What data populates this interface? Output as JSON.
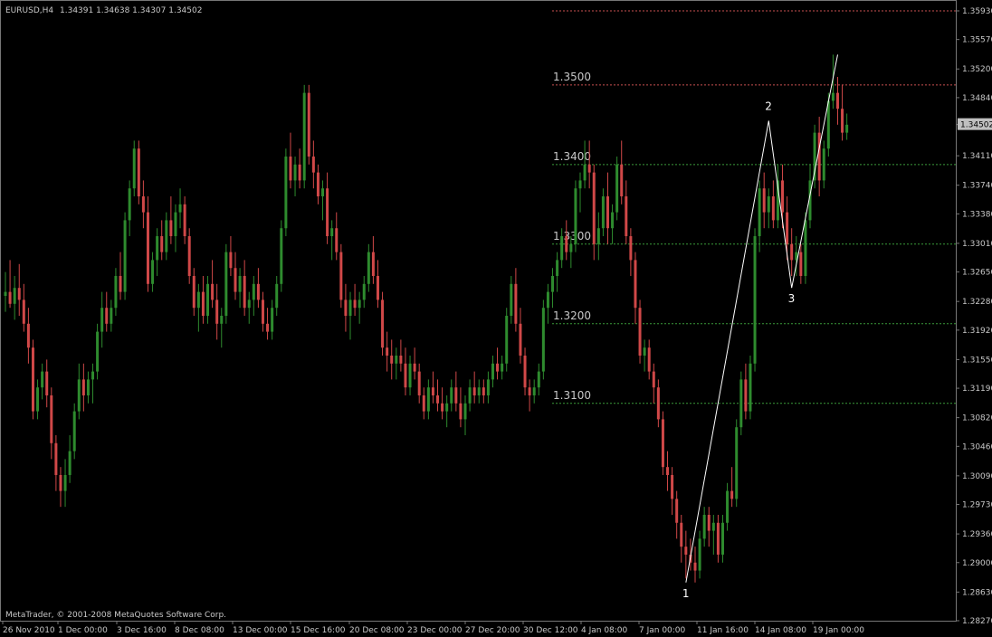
{
  "header": {
    "symbol": "EURUSD,H4",
    "quote": "1.34391 1.34638 1.34307 1.34502"
  },
  "footer": {
    "copyright": "MetaTrader, © 2001-2008 MetaQuotes Software Corp."
  },
  "colors": {
    "background": "#000000",
    "bull": "#2e8b2e",
    "bear": "#d04848",
    "grid": "#555555",
    "wave": "#ffffff",
    "price_marker": "#c0c0c0"
  },
  "chart_data": {
    "type": "candlestick",
    "symbol": "EURUSD",
    "timeframe": "H4",
    "ylim": [
      1.2827,
      1.3593
    ],
    "y_ticks": [
      "1.35930",
      "1.35570",
      "1.35200",
      "1.34840",
      "1.34502",
      "1.34110",
      "1.33740",
      "1.33380",
      "1.33010",
      "1.32650",
      "1.32280",
      "1.31920",
      "1.31550",
      "1.31190",
      "1.30820",
      "1.30460",
      "1.30090",
      "1.29730",
      "1.29360",
      "1.29000",
      "1.28630",
      "1.28270"
    ],
    "x_ticks": [
      "26 Nov 2010",
      "1 Dec 00:00",
      "3 Dec 16:00",
      "8 Dec 08:00",
      "13 Dec 00:00",
      "15 Dec 16:00",
      "20 Dec 08:00",
      "23 Dec 00:00",
      "27 Dec 20:00",
      "30 Dec 12:00",
      "4 Jan 08:00",
      "7 Jan 00:00",
      "11 Jan 16:00",
      "14 Jan 08:00",
      "19 Jan 00:00"
    ],
    "current_price": "1.34502",
    "levels": [
      {
        "label": "",
        "value": 1.3593
      },
      {
        "label": "1.3500",
        "value": 1.35
      },
      {
        "label": "1.3400",
        "value": 1.34
      },
      {
        "label": "1.3300",
        "value": 1.33
      },
      {
        "label": "1.3200",
        "value": 1.32
      },
      {
        "label": "1.3100",
        "value": 1.31
      }
    ],
    "wave_points": [
      {
        "label": "",
        "index": 148,
        "price": 1.2875
      },
      {
        "label": "",
        "index": 166,
        "price": 1.3455
      },
      {
        "label": "",
        "index": 171,
        "price": 1.3245
      },
      {
        "label": "",
        "index": 181,
        "price": 1.3538
      }
    ],
    "wave_labels": [
      {
        "label": "1",
        "index": 148,
        "price": 1.2875
      },
      {
        "label": "2",
        "index": 166,
        "price": 1.3455
      },
      {
        "label": "3",
        "index": 171,
        "price": 1.3245
      }
    ],
    "candles": [
      [
        1.3235,
        1.3265,
        1.3215,
        1.324
      ],
      [
        1.324,
        1.328,
        1.322,
        1.3225
      ],
      [
        1.3225,
        1.326,
        1.3205,
        1.3245
      ],
      [
        1.3245,
        1.3275,
        1.321,
        1.323
      ],
      [
        1.323,
        1.325,
        1.319,
        1.32
      ],
      [
        1.32,
        1.322,
        1.315,
        1.317
      ],
      [
        1.317,
        1.318,
        1.308,
        1.309
      ],
      [
        1.309,
        1.313,
        1.308,
        1.312
      ],
      [
        1.312,
        1.315,
        1.3105,
        1.314
      ],
      [
        1.314,
        1.3155,
        1.3095,
        1.311
      ],
      [
        1.311,
        1.312,
        1.303,
        1.305
      ],
      [
        1.305,
        1.306,
        1.299,
        1.301
      ],
      [
        1.301,
        1.302,
        1.297,
        1.299
      ],
      [
        1.299,
        1.303,
        1.297,
        1.301
      ],
      [
        1.301,
        1.306,
        1.3,
        1.304
      ],
      [
        1.304,
        1.31,
        1.303,
        1.309
      ],
      [
        1.309,
        1.315,
        1.308,
        1.313
      ],
      [
        1.313,
        1.315,
        1.309,
        1.311
      ],
      [
        1.311,
        1.314,
        1.31,
        1.313
      ],
      [
        1.313,
        1.315,
        1.31,
        1.314
      ],
      [
        1.314,
        1.32,
        1.313,
        1.319
      ],
      [
        1.319,
        1.324,
        1.317,
        1.322
      ],
      [
        1.322,
        1.324,
        1.319,
        1.32
      ],
      [
        1.32,
        1.323,
        1.319,
        1.322
      ],
      [
        1.322,
        1.327,
        1.321,
        1.326
      ],
      [
        1.326,
        1.329,
        1.323,
        1.324
      ],
      [
        1.324,
        1.334,
        1.323,
        1.333
      ],
      [
        1.333,
        1.338,
        1.331,
        1.337
      ],
      [
        1.337,
        1.343,
        1.336,
        1.342
      ],
      [
        1.342,
        1.343,
        1.335,
        1.336
      ],
      [
        1.336,
        1.338,
        1.332,
        1.334
      ],
      [
        1.334,
        1.336,
        1.324,
        1.325
      ],
      [
        1.325,
        1.329,
        1.324,
        1.328
      ],
      [
        1.328,
        1.332,
        1.326,
        1.331
      ],
      [
        1.331,
        1.333,
        1.328,
        1.329
      ],
      [
        1.329,
        1.334,
        1.328,
        1.333
      ],
      [
        1.333,
        1.336,
        1.33,
        1.331
      ],
      [
        1.331,
        1.335,
        1.329,
        1.334
      ],
      [
        1.334,
        1.337,
        1.332,
        1.335
      ],
      [
        1.335,
        1.336,
        1.33,
        1.331
      ],
      [
        1.331,
        1.332,
        1.325,
        1.326
      ],
      [
        1.326,
        1.327,
        1.321,
        1.322
      ],
      [
        1.322,
        1.325,
        1.319,
        1.324
      ],
      [
        1.324,
        1.326,
        1.32,
        1.321
      ],
      [
        1.321,
        1.326,
        1.32,
        1.325
      ],
      [
        1.325,
        1.328,
        1.322,
        1.323
      ],
      [
        1.323,
        1.325,
        1.318,
        1.32
      ],
      [
        1.32,
        1.322,
        1.317,
        1.321
      ],
      [
        1.321,
        1.33,
        1.32,
        1.329
      ],
      [
        1.329,
        1.331,
        1.326,
        1.327
      ],
      [
        1.327,
        1.329,
        1.323,
        1.324
      ],
      [
        1.324,
        1.327,
        1.322,
        1.326
      ],
      [
        1.326,
        1.328,
        1.321,
        1.322
      ],
      [
        1.322,
        1.324,
        1.32,
        1.323
      ],
      [
        1.323,
        1.326,
        1.321,
        1.325
      ],
      [
        1.325,
        1.327,
        1.322,
        1.323
      ],
      [
        1.323,
        1.324,
        1.319,
        1.32
      ],
      [
        1.32,
        1.322,
        1.318,
        1.319
      ],
      [
        1.319,
        1.323,
        1.318,
        1.322
      ],
      [
        1.322,
        1.326,
        1.321,
        1.325
      ],
      [
        1.325,
        1.333,
        1.324,
        1.332
      ],
      [
        1.332,
        1.342,
        1.331,
        1.341
      ],
      [
        1.341,
        1.344,
        1.337,
        1.338
      ],
      [
        1.338,
        1.341,
        1.336,
        1.34
      ],
      [
        1.34,
        1.342,
        1.337,
        1.338
      ],
      [
        1.338,
        1.35,
        1.337,
        1.349
      ],
      [
        1.349,
        1.35,
        1.34,
        1.341
      ],
      [
        1.341,
        1.343,
        1.337,
        1.339
      ],
      [
        1.339,
        1.34,
        1.335,
        1.336
      ],
      [
        1.336,
        1.338,
        1.333,
        1.337
      ],
      [
        1.337,
        1.339,
        1.33,
        1.331
      ],
      [
        1.331,
        1.333,
        1.328,
        1.332
      ],
      [
        1.332,
        1.334,
        1.328,
        1.329
      ],
      [
        1.329,
        1.33,
        1.322,
        1.323
      ],
      [
        1.323,
        1.325,
        1.319,
        1.321
      ],
      [
        1.321,
        1.324,
        1.318,
        1.323
      ],
      [
        1.323,
        1.325,
        1.321,
        1.322
      ],
      [
        1.322,
        1.324,
        1.32,
        1.323
      ],
      [
        1.323,
        1.326,
        1.322,
        1.325
      ],
      [
        1.325,
        1.33,
        1.324,
        1.329
      ],
      [
        1.329,
        1.331,
        1.325,
        1.326
      ],
      [
        1.326,
        1.328,
        1.322,
        1.323
      ],
      [
        1.323,
        1.324,
        1.316,
        1.317
      ],
      [
        1.317,
        1.319,
        1.314,
        1.316
      ],
      [
        1.316,
        1.318,
        1.313,
        1.315
      ],
      [
        1.315,
        1.317,
        1.313,
        1.316
      ],
      [
        1.316,
        1.318,
        1.314,
        1.315
      ],
      [
        1.315,
        1.317,
        1.311,
        1.312
      ],
      [
        1.312,
        1.316,
        1.311,
        1.315
      ],
      [
        1.315,
        1.317,
        1.313,
        1.314
      ],
      [
        1.314,
        1.315,
        1.31,
        1.311
      ],
      [
        1.311,
        1.312,
        1.308,
        1.309
      ],
      [
        1.309,
        1.313,
        1.308,
        1.312
      ],
      [
        1.312,
        1.314,
        1.31,
        1.311
      ],
      [
        1.311,
        1.313,
        1.309,
        1.31
      ],
      [
        1.31,
        1.312,
        1.308,
        1.309
      ],
      [
        1.309,
        1.311,
        1.307,
        1.31
      ],
      [
        1.31,
        1.313,
        1.309,
        1.312
      ],
      [
        1.312,
        1.314,
        1.309,
        1.31
      ],
      [
        1.31,
        1.312,
        1.307,
        1.308
      ],
      [
        1.308,
        1.311,
        1.306,
        1.31
      ],
      [
        1.31,
        1.313,
        1.309,
        1.312
      ],
      [
        1.312,
        1.314,
        1.31,
        1.311
      ],
      [
        1.311,
        1.313,
        1.31,
        1.312
      ],
      [
        1.312,
        1.313,
        1.31,
        1.311
      ],
      [
        1.311,
        1.314,
        1.31,
        1.313
      ],
      [
        1.313,
        1.316,
        1.312,
        1.315
      ],
      [
        1.315,
        1.317,
        1.313,
        1.314
      ],
      [
        1.314,
        1.316,
        1.313,
        1.315
      ],
      [
        1.315,
        1.322,
        1.314,
        1.321
      ],
      [
        1.321,
        1.326,
        1.32,
        1.325
      ],
      [
        1.325,
        1.327,
        1.319,
        1.32
      ],
      [
        1.32,
        1.322,
        1.315,
        1.316
      ],
      [
        1.316,
        1.317,
        1.311,
        1.312
      ],
      [
        1.312,
        1.313,
        1.309,
        1.311
      ],
      [
        1.311,
        1.313,
        1.31,
        1.312
      ],
      [
        1.312,
        1.315,
        1.311,
        1.314
      ],
      [
        1.314,
        1.323,
        1.313,
        1.322
      ],
      [
        1.322,
        1.325,
        1.32,
        1.324
      ],
      [
        1.324,
        1.327,
        1.322,
        1.326
      ],
      [
        1.326,
        1.329,
        1.324,
        1.328
      ],
      [
        1.328,
        1.332,
        1.327,
        1.331
      ],
      [
        1.331,
        1.333,
        1.328,
        1.329
      ],
      [
        1.329,
        1.331,
        1.327,
        1.33
      ],
      [
        1.33,
        1.338,
        1.329,
        1.337
      ],
      [
        1.337,
        1.339,
        1.334,
        1.338
      ],
      [
        1.338,
        1.343,
        1.337,
        1.34
      ],
      [
        1.34,
        1.343,
        1.337,
        1.339
      ],
      [
        1.339,
        1.34,
        1.328,
        1.33
      ],
      [
        1.33,
        1.334,
        1.328,
        1.332
      ],
      [
        1.332,
        1.337,
        1.331,
        1.336
      ],
      [
        1.336,
        1.339,
        1.33,
        1.332
      ],
      [
        1.332,
        1.335,
        1.33,
        1.334
      ],
      [
        1.334,
        1.341,
        1.333,
        1.34
      ],
      [
        1.34,
        1.343,
        1.335,
        1.336
      ],
      [
        1.336,
        1.338,
        1.33,
        1.331
      ],
      [
        1.331,
        1.332,
        1.326,
        1.328
      ],
      [
        1.328,
        1.329,
        1.32,
        1.322
      ],
      [
        1.322,
        1.323,
        1.315,
        1.316
      ],
      [
        1.316,
        1.318,
        1.314,
        1.317
      ],
      [
        1.317,
        1.318,
        1.313,
        1.314
      ],
      [
        1.314,
        1.315,
        1.31,
        1.312
      ],
      [
        1.312,
        1.313,
        1.307,
        1.308
      ],
      [
        1.308,
        1.309,
        1.301,
        1.302
      ],
      [
        1.302,
        1.304,
        1.299,
        1.301
      ],
      [
        1.301,
        1.302,
        1.296,
        1.298
      ],
      [
        1.298,
        1.299,
        1.293,
        1.295
      ],
      [
        1.295,
        1.296,
        1.29,
        1.292
      ],
      [
        1.292,
        1.294,
        1.288,
        1.291
      ],
      [
        1.291,
        1.293,
        1.289,
        1.29
      ],
      [
        1.29,
        1.292,
        1.2875,
        1.289
      ],
      [
        1.289,
        1.294,
        1.288,
        1.293
      ],
      [
        1.293,
        1.297,
        1.292,
        1.296
      ],
      [
        1.296,
        1.297,
        1.292,
        1.294
      ],
      [
        1.294,
        1.296,
        1.291,
        1.295
      ],
      [
        1.295,
        1.296,
        1.29,
        1.291
      ],
      [
        1.291,
        1.296,
        1.29,
        1.295
      ],
      [
        1.295,
        1.3,
        1.294,
        1.299
      ],
      [
        1.299,
        1.302,
        1.297,
        1.298
      ],
      [
        1.298,
        1.308,
        1.297,
        1.307
      ],
      [
        1.307,
        1.314,
        1.306,
        1.313
      ],
      [
        1.313,
        1.315,
        1.308,
        1.309
      ],
      [
        1.309,
        1.316,
        1.308,
        1.315
      ],
      [
        1.315,
        1.332,
        1.314,
        1.331
      ],
      [
        1.331,
        1.338,
        1.329,
        1.337
      ],
      [
        1.337,
        1.339,
        1.332,
        1.334
      ],
      [
        1.334,
        1.337,
        1.332,
        1.336
      ],
      [
        1.336,
        1.338,
        1.332,
        1.333
      ],
      [
        1.333,
        1.34,
        1.332,
        1.338
      ],
      [
        1.338,
        1.34,
        1.332,
        1.334
      ],
      [
        1.334,
        1.336,
        1.328,
        1.33
      ],
      [
        1.33,
        1.332,
        1.326,
        1.328
      ],
      [
        1.328,
        1.331,
        1.326,
        1.329
      ],
      [
        1.329,
        1.33,
        1.325,
        1.326
      ],
      [
        1.326,
        1.334,
        1.325,
        1.333
      ],
      [
        1.333,
        1.34,
        1.332,
        1.338
      ],
      [
        1.338,
        1.345,
        1.337,
        1.344
      ],
      [
        1.344,
        1.346,
        1.336,
        1.338
      ],
      [
        1.338,
        1.343,
        1.337,
        1.342
      ],
      [
        1.342,
        1.349,
        1.341,
        1.348
      ],
      [
        1.348,
        1.3538,
        1.347,
        1.349
      ],
      [
        1.349,
        1.351,
        1.345,
        1.347
      ],
      [
        1.347,
        1.35,
        1.343,
        1.344
      ],
      [
        1.344,
        1.3464,
        1.3431,
        1.345
      ]
    ]
  }
}
